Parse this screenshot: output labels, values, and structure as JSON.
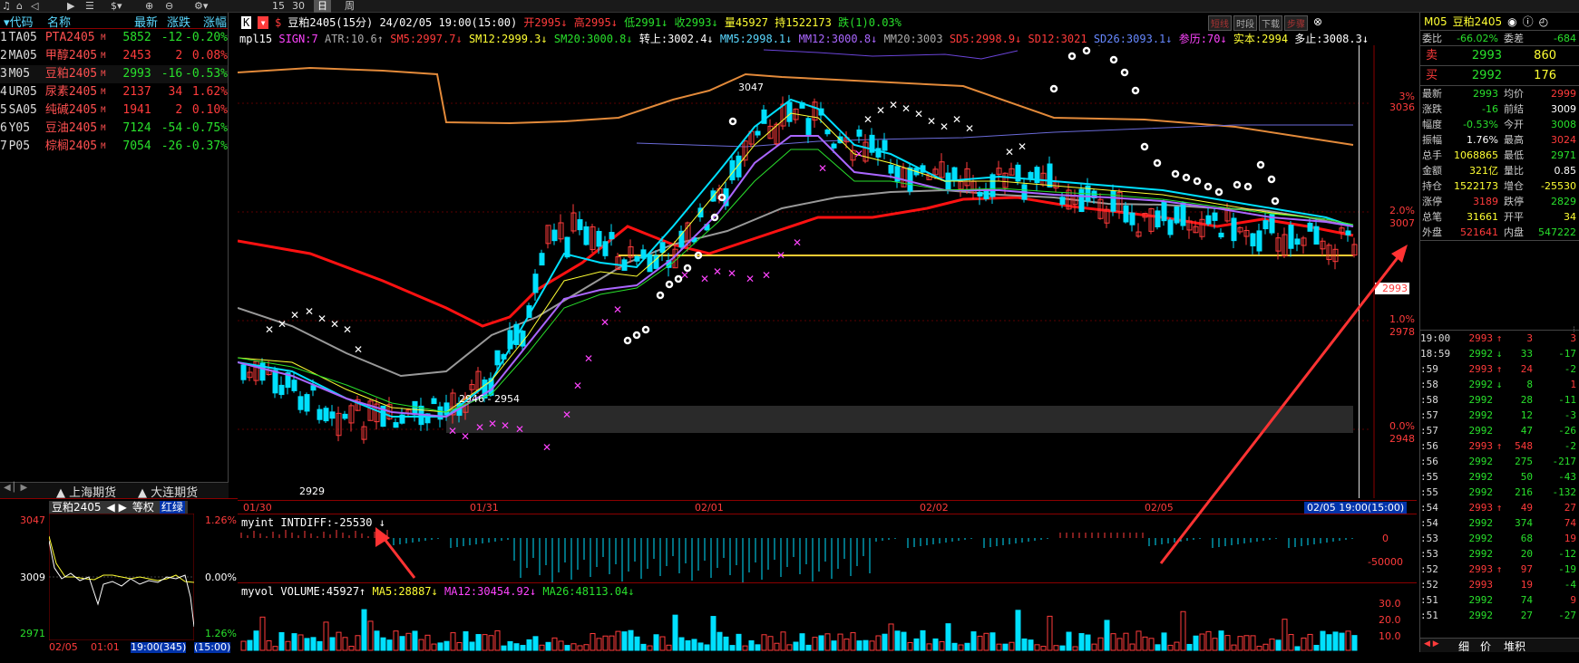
{
  "toolbar": {
    "time_label_1": "15",
    "time_label_2": "30",
    "period_day": "日",
    "period_week": "周"
  },
  "watchlist": {
    "headers": [
      "代码",
      "名称",
      "最新",
      "涨跌",
      "涨幅"
    ],
    "rows": [
      {
        "idx": "1",
        "code": "TA05",
        "name": "PTA2405",
        "last": "5852",
        "chg": "-12",
        "pct": "-0.20%",
        "dir": "down"
      },
      {
        "idx": "2",
        "code": "MA05",
        "name": "甲醇2405",
        "last": "2453",
        "chg": "2",
        "pct": "0.08%",
        "dir": "up"
      },
      {
        "idx": "3",
        "code": "M05",
        "name": "豆粕2405",
        "last": "2993",
        "chg": "-16",
        "pct": "-0.53%",
        "dir": "down"
      },
      {
        "idx": "4",
        "code": "UR05",
        "name": "尿素2405",
        "last": "2137",
        "chg": "34",
        "pct": "1.62%",
        "dir": "up"
      },
      {
        "idx": "5",
        "code": "SA05",
        "name": "纯碱2405",
        "last": "1941",
        "chg": "2",
        "pct": "0.10%",
        "dir": "up"
      },
      {
        "idx": "6",
        "code": "Y05",
        "name": "豆油2405",
        "last": "7124",
        "chg": "-54",
        "pct": "-0.75%",
        "dir": "down"
      },
      {
        "idx": "7",
        "code": "P05",
        "name": "棕榈2405",
        "last": "7054",
        "chg": "-26",
        "pct": "-0.37%",
        "dir": "down"
      }
    ],
    "m_badge": "M",
    "tabs": [
      "上海期货",
      "大连期货"
    ]
  },
  "mini": {
    "title": "豆粕2405",
    "equal_weight": "等权",
    "red_green": "红绿",
    "y_top": "3047",
    "y_mid": "3009",
    "y_bot": "2971",
    "pct_top": "1.26%",
    "pct_mid": "0.00%",
    "pct_bot": "1.26%",
    "x_left": "02/05",
    "x_mid": "01:01",
    "x_right": "19:00(345)",
    "x_period": "(15:00)"
  },
  "chart_header": {
    "k_badge": "K",
    "s_badge": "$",
    "title": "豆粕2405(15分)",
    "datetime": "24/02/05 19:00(15:00)",
    "open": "开2995",
    "high": "高2995",
    "low": "低2991",
    "close": "收2993",
    "volume": "量45927",
    "hold": "持1522173",
    "fall": "跌(1)0.03%",
    "buttons": [
      "短线",
      "时段",
      "下载",
      "步骤"
    ]
  },
  "indicator_line": {
    "name": "mpl15",
    "sign": "SIGN:7",
    "atr": "ATR:10.6",
    "sm5": "SM5:2997.7",
    "sm12": "SM12:2999.3",
    "sm20": "SM20:3000.8",
    "zhuanshang": "转上:3002.4",
    "mm5": "MM5:2998.1",
    "mm12": "MM12:3000.8",
    "mm20": "MM20:3003",
    "sd5": "SD5:2998.9",
    "sd12": "SD12:3021",
    "sd26": "SD26:3093.1",
    "canli": "参历:70",
    "shiben": "实本:2994",
    "duozhi": "多止:3008.3"
  },
  "price_axis": [
    "3036",
    "3%",
    "2.0%",
    "3007",
    "1.0%",
    "2978",
    "0.0%",
    "2948"
  ],
  "price_tag": "2993",
  "annotations": {
    "high_label": "3047",
    "low_label": "2929",
    "box_label": "2946 - 2954"
  },
  "time_axis": [
    "01/30",
    "01/31",
    "02/01",
    "02/02",
    "02/05"
  ],
  "time_cursor": "02/05 19:00(15:00)",
  "myint": {
    "label": "myint INTDIFF:-25530",
    "axis_top": "0",
    "axis_bot": "-50000"
  },
  "myvol": {
    "label": "myvol VOLUME:45927",
    "ma5": "MA5:28887",
    "ma12": "MA12:30454.92",
    "ma26": "MA26:48113.04",
    "axis_top": "30.0",
    "axis_mid": "20.0",
    "axis_bot": "10.0"
  },
  "right_panel": {
    "code": "M05",
    "name": "豆粕2405",
    "weibi_label": "委比",
    "weibi": "-66.02%",
    "weicha_label": "委差",
    "weicha": "-684",
    "sell_label": "卖",
    "sell_price": "2993",
    "sell_vol": "860",
    "buy_label": "买",
    "buy_price": "2992",
    "buy_vol": "176",
    "stats": [
      {
        "l1": "最新",
        "v1": "2993",
        "c1": "grn",
        "l2": "均价",
        "v2": "2999",
        "c2": "red"
      },
      {
        "l1": "涨跌",
        "v1": "-16",
        "c1": "grn",
        "l2": "前结",
        "v2": "3009",
        "c2": "wht"
      },
      {
        "l1": "幅度",
        "v1": "-0.53%",
        "c1": "grn",
        "l2": "今开",
        "v2": "3008",
        "c2": "grn"
      },
      {
        "l1": "振幅",
        "v1": "1.76%",
        "c1": "wht",
        "l2": "最高",
        "v2": "3024",
        "c2": "red"
      },
      {
        "l1": "总手",
        "v1": "1068865",
        "c1": "yel",
        "l2": "最低",
        "v2": "2971",
        "c2": "grn"
      },
      {
        "l1": "金额",
        "v1": "321亿",
        "c1": "yel",
        "l2": "量比",
        "v2": "0.85",
        "c2": "wht"
      },
      {
        "l1": "持仓",
        "v1": "1522173",
        "c1": "yel",
        "l2": "增仓",
        "v2": "-25530",
        "c2": "yel"
      },
      {
        "l1": "涨停",
        "v1": "3189",
        "c1": "red",
        "l2": "跌停",
        "v2": "2829",
        "c2": "grn"
      },
      {
        "l1": "总笔",
        "v1": "31661",
        "c1": "yel",
        "l2": "开平",
        "v2": "34",
        "c2": "yel"
      },
      {
        "l1": "外盘",
        "v1": "521641",
        "c1": "red",
        "l2": "内盘",
        "v2": "547222",
        "c2": "grn"
      }
    ],
    "ticks": [
      {
        "t": "19:00",
        "p": "2993",
        "a": "↑",
        "ac": "red",
        "v": "3",
        "o": "3",
        "oc": "red"
      },
      {
        "t": "18:59",
        "p": "2992",
        "a": "↓",
        "ac": "grn",
        "v": "33",
        "o": "-17",
        "oc": "grn"
      },
      {
        "t": ":59",
        "p": "2993",
        "a": "↑",
        "ac": "red",
        "v": "24",
        "o": "-2",
        "oc": "grn"
      },
      {
        "t": ":58",
        "p": "2992",
        "a": "↓",
        "ac": "grn",
        "v": "8",
        "o": "1",
        "oc": "red"
      },
      {
        "t": ":58",
        "p": "2992",
        "a": "",
        "ac": "grn",
        "v": "28",
        "o": "-11",
        "oc": "grn"
      },
      {
        "t": ":57",
        "p": "2992",
        "a": "",
        "ac": "grn",
        "v": "12",
        "o": "-3",
        "oc": "grn"
      },
      {
        "t": ":57",
        "p": "2992",
        "a": "",
        "ac": "grn",
        "v": "47",
        "o": "-26",
        "oc": "grn"
      },
      {
        "t": ":56",
        "p": "2993",
        "a": "↑",
        "ac": "red",
        "v": "548",
        "o": "-2",
        "oc": "grn"
      },
      {
        "t": ":56",
        "p": "2992",
        "a": "",
        "ac": "grn",
        "v": "275",
        "o": "-217",
        "oc": "grn"
      },
      {
        "t": ":55",
        "p": "2992",
        "a": "",
        "ac": "grn",
        "v": "50",
        "o": "-43",
        "oc": "grn"
      },
      {
        "t": ":55",
        "p": "2992",
        "a": "",
        "ac": "grn",
        "v": "216",
        "o": "-132",
        "oc": "grn"
      },
      {
        "t": ":54",
        "p": "2993",
        "a": "↑",
        "ac": "red",
        "v": "49",
        "o": "27",
        "oc": "red"
      },
      {
        "t": ":54",
        "p": "2992",
        "a": "",
        "ac": "grn",
        "v": "374",
        "o": "74",
        "oc": "red"
      },
      {
        "t": ":53",
        "p": "2992",
        "a": "",
        "ac": "grn",
        "v": "68",
        "o": "19",
        "oc": "red"
      },
      {
        "t": ":53",
        "p": "2992",
        "a": "",
        "ac": "grn",
        "v": "20",
        "o": "-12",
        "oc": "grn"
      },
      {
        "t": ":52",
        "p": "2993",
        "a": "↑",
        "ac": "red",
        "v": "97",
        "o": "-19",
        "oc": "grn"
      },
      {
        "t": ":52",
        "p": "2993",
        "a": "",
        "ac": "red",
        "v": "19",
        "o": "-4",
        "oc": "grn"
      },
      {
        "t": ":51",
        "p": "2992",
        "a": "",
        "ac": "grn",
        "v": "74",
        "o": "9",
        "oc": "red"
      },
      {
        "t": ":51",
        "p": "2992",
        "a": "",
        "ac": "grn",
        "v": "27",
        "o": "-27",
        "oc": "grn"
      }
    ],
    "bottom_tabs": [
      "细",
      "价",
      "堆积"
    ]
  },
  "colors": {
    "up": "#ff3b3b",
    "down": "#29e02c",
    "accent": "#5ad8ff",
    "grid": "#8b0000",
    "yellow": "#ffff33"
  }
}
